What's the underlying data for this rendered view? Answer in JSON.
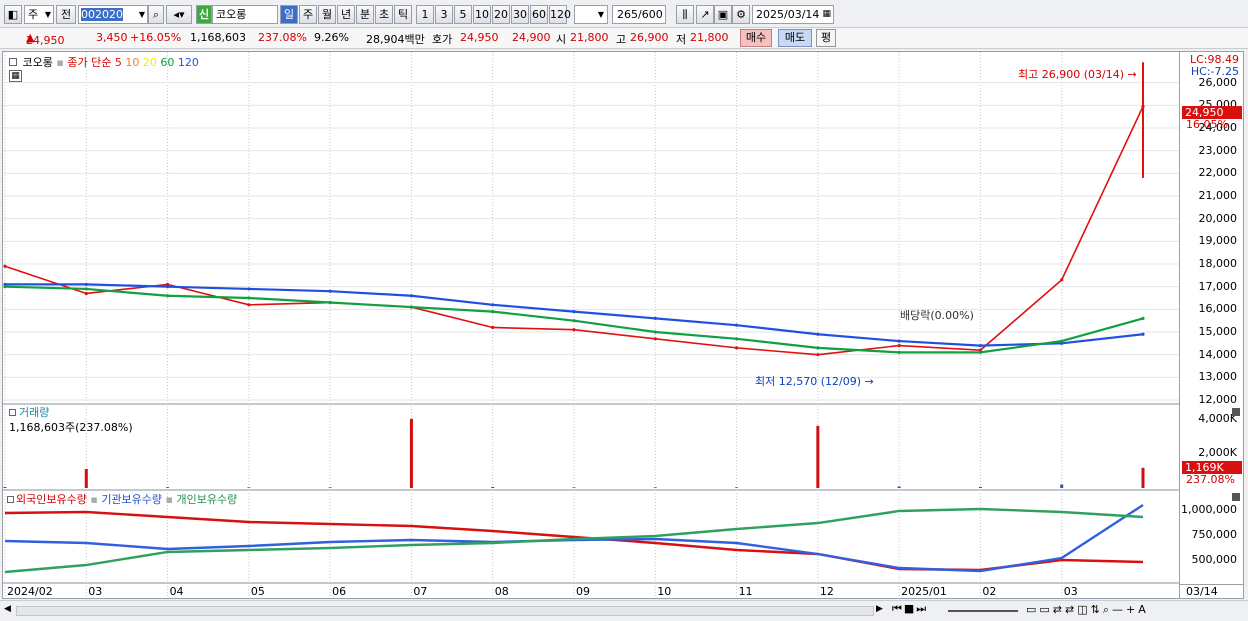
{
  "toolbar": {
    "market_type": "주",
    "prev_label": "전",
    "stock_code": "002020",
    "new_badge": "신",
    "stock_name": "코오롱",
    "periods": [
      "일",
      "주",
      "월",
      "년",
      "분",
      "초",
      "틱"
    ],
    "intervals": [
      "1",
      "3",
      "5",
      "10",
      "20",
      "30",
      "60",
      "120"
    ],
    "count": "265",
    "count_total": "/600",
    "date": "2025/03/14"
  },
  "info": {
    "price": "24,950",
    "change": "3,450",
    "change_pct": "+16.05%",
    "volume": "1,168,603",
    "volume_ratio": "237.08%",
    "turnover": "9.26%",
    "amount": "28,904백만",
    "bid_label": "호가",
    "ask_price": "24,950",
    "bid_price": "24,900",
    "open_label": "시",
    "open": "21,800",
    "high_label": "고",
    "high": "26,900",
    "low_label": "저",
    "low": "21,800",
    "buy_label": "매수",
    "sell_label": "매도",
    "eval_label": "평"
  },
  "price_panel": {
    "stock_label": "코오롱",
    "ma_label": "종가 단순",
    "ma_periods": [
      "5",
      "10",
      "20",
      "60",
      "120"
    ],
    "ma_colors": [
      "#e01010",
      "#f08020",
      "#f0f000",
      "#10a040",
      "#2050e0"
    ],
    "high_annotation": "최고 26,900 (03/14)",
    "low_annotation": "최저 12,570 (12/09)",
    "event_annotation": "배당락(0.00%)",
    "lc": "LC:98.49",
    "hc": "HC:-7.25",
    "current_price_tag": "24,950",
    "current_pct_tag": "16.05%"
  },
  "volume_panel": {
    "title": "거래량",
    "value": "1,168,603주(237.08%)",
    "tag": "1,169K",
    "tag_pct": "237.08%"
  },
  "holding_panel": {
    "legend": [
      "외국인보유수량",
      "기관보유수량",
      "개인보유수량"
    ],
    "colors": [
      "#d81010",
      "#3060e0",
      "#30a060"
    ]
  },
  "x_labels": [
    "2024/02",
    "03",
    "04",
    "05",
    "06",
    "07",
    "08",
    "09",
    "10",
    "11",
    "12",
    "2025/01",
    "02",
    "03"
  ],
  "x_axis_tag": "03/14",
  "chart_data": [
    {
      "type": "line",
      "title": "코오롱",
      "ylim": [
        12000,
        27000
      ],
      "y_ticks": [
        12000,
        13000,
        14000,
        15000,
        16000,
        17000,
        18000,
        19000,
        20000,
        21000,
        22000,
        23000,
        24000,
        25000,
        26000
      ],
      "x": [
        "2024/02",
        "03",
        "04",
        "05",
        "06",
        "07",
        "08",
        "09",
        "10",
        "11",
        "12",
        "2025/01",
        "02",
        "03",
        "03/14"
      ],
      "series": [
        {
          "name": "종가",
          "values": [
            17900,
            16700,
            17100,
            16200,
            16300,
            16100,
            15200,
            15100,
            14700,
            14300,
            14000,
            14400,
            14200,
            17300,
            24950
          ]
        },
        {
          "name": "120",
          "values": [
            17100,
            17100,
            17000,
            16900,
            16800,
            16600,
            16200,
            15900,
            15600,
            15300,
            14900,
            14600,
            14400,
            14500,
            14900
          ]
        },
        {
          "name": "60",
          "values": [
            17000,
            16900,
            16600,
            16500,
            16300,
            16100,
            15900,
            15500,
            15000,
            14700,
            14300,
            14100,
            14100,
            14600,
            15600
          ]
        }
      ]
    },
    {
      "type": "bar",
      "title": "거래량",
      "y_ticks": [
        2000000,
        4000000
      ],
      "x": [
        "2024/02",
        "03",
        "04",
        "05",
        "06",
        "07",
        "08",
        "09",
        "10",
        "11",
        "12",
        "2025/01",
        "02",
        "03",
        "03/14"
      ],
      "values": [
        60000,
        1100000,
        50000,
        40000,
        40000,
        4000000,
        60000,
        40000,
        40000,
        40000,
        3600000,
        90000,
        60000,
        200000,
        1168603
      ]
    },
    {
      "type": "line",
      "title": "보유수량",
      "y_ticks": [
        500000,
        750000,
        1000000
      ],
      "x": [
        "2024/02",
        "03",
        "04",
        "05",
        "06",
        "07",
        "08",
        "09",
        "10",
        "11",
        "12",
        "2025/01",
        "02",
        "03",
        "03/14"
      ],
      "series": [
        {
          "name": "외국인보유수량",
          "values": [
            970000,
            980000,
            930000,
            880000,
            860000,
            840000,
            790000,
            730000,
            670000,
            600000,
            560000,
            410000,
            400000,
            500000,
            480000
          ]
        },
        {
          "name": "기관보유수량",
          "values": [
            690000,
            670000,
            610000,
            640000,
            680000,
            700000,
            680000,
            700000,
            710000,
            670000,
            560000,
            420000,
            390000,
            520000,
            1050000
          ]
        },
        {
          "name": "개인보유수량",
          "values": [
            380000,
            450000,
            580000,
            600000,
            620000,
            650000,
            670000,
            710000,
            740000,
            810000,
            870000,
            990000,
            1010000,
            980000,
            930000
          ]
        }
      ]
    }
  ]
}
